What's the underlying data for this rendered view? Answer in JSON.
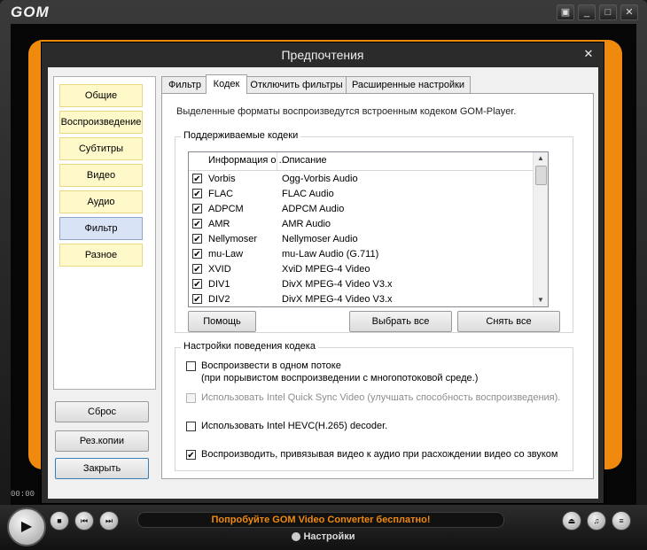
{
  "app": {
    "logo": "GOM",
    "timecode": "00:00",
    "window_controls": [
      "tray-icon",
      "minimize-icon",
      "maximize-icon",
      "close-icon"
    ]
  },
  "dialog": {
    "title": "Предпочтения",
    "close_glyph": "✕",
    "categories": [
      {
        "label": "Общие",
        "selected": false
      },
      {
        "label": "Воспроизведение",
        "selected": false
      },
      {
        "label": "Субтитры",
        "selected": false
      },
      {
        "label": "Видео",
        "selected": false
      },
      {
        "label": "Аудио",
        "selected": false
      },
      {
        "label": "Фильтр",
        "selected": true
      },
      {
        "label": "Разное",
        "selected": false
      }
    ],
    "left_buttons": {
      "reset": "Сброс",
      "backup": "Рез.копии",
      "close": "Закрыть"
    },
    "tabs": [
      {
        "label": "Фильтр",
        "active": false
      },
      {
        "label": "Кодек",
        "active": true
      },
      {
        "label": "Отключить фильтры",
        "active": false
      },
      {
        "label": "Расширенные настройки",
        "active": false
      }
    ],
    "codec_tab": {
      "description": "Выделенные форматы воспроизведутся встроенным кодеком GOM-Player.",
      "supported_group_label": "Поддерживаемые кодеки",
      "columns": [
        "Информация о ...",
        "Описание"
      ],
      "rows": [
        {
          "name": "Vorbis",
          "description": "Ogg-Vorbis Audio",
          "checked": true
        },
        {
          "name": "FLAC",
          "description": "FLAC Audio",
          "checked": true
        },
        {
          "name": "ADPCM",
          "description": "ADPCM Audio",
          "checked": true
        },
        {
          "name": "AMR",
          "description": "AMR Audio",
          "checked": true
        },
        {
          "name": "Nellymoser",
          "description": "Nellymoser Audio",
          "checked": true
        },
        {
          "name": "mu-Law",
          "description": "mu-Law Audio (G.711)",
          "checked": true
        },
        {
          "name": "XVID",
          "description": "XviD MPEG-4 Video",
          "checked": true
        },
        {
          "name": "DIV1",
          "description": "DivX MPEG-4 Video V3.x",
          "checked": true
        },
        {
          "name": "DIV2",
          "description": "DivX MPEG-4 Video V3.x",
          "checked": true
        }
      ],
      "buttons": {
        "help": "Помощь",
        "select_all": "Выбрать все",
        "deselect_all": "Снять все"
      },
      "behavior_group_label": "Настройки поведения кодека",
      "options": [
        {
          "text": "Воспроизвести в одном потоке",
          "text2": "(при порывистом воспроизведении с многопотоковой среде.)",
          "checked": false,
          "disabled": false
        },
        {
          "text": "Использовать Intel Quick Sync Video (улучшать способность воспроизведения).",
          "checked": false,
          "disabled": true
        },
        {
          "text": "Использовать Intel HEVC(H.265) decoder.",
          "checked": false,
          "disabled": false
        },
        {
          "text": "Воспроизводить, привязывая видео к аудио при расхождении видео со звуком",
          "checked": true,
          "disabled": false
        }
      ]
    }
  },
  "player": {
    "promo": "Попробуйте GOM Video Converter бесплатно!",
    "settings_label": "Настройки",
    "accent_color": "#f08a0e"
  }
}
